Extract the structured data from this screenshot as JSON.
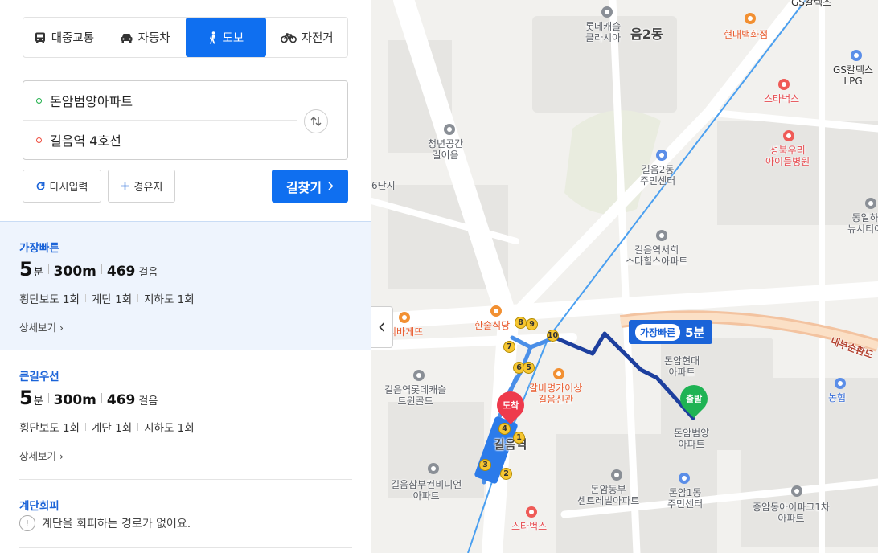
{
  "modes": [
    {
      "label": "대중교통",
      "icon": "bus-icon",
      "active": false
    },
    {
      "label": "자동차",
      "icon": "car-icon",
      "active": false
    },
    {
      "label": "도보",
      "icon": "walk-icon",
      "active": true
    },
    {
      "label": "자전거",
      "icon": "bicycle-icon",
      "active": false
    }
  ],
  "route": {
    "start": "돈암범양아파트",
    "end": "길음역 4호선"
  },
  "actions": {
    "reset": "다시입력",
    "waypoint": "경유지",
    "search": "길찾기"
  },
  "results": [
    {
      "title": "가장빠른",
      "minutes": "5",
      "minutes_unit": "분",
      "distance": "300m",
      "steps": "469",
      "steps_unit": "걸음",
      "details": [
        "횡단보도 1회",
        "계단 1회",
        "지하도 1회"
      ],
      "more": "상세보기"
    },
    {
      "title": "큰길우선",
      "minutes": "5",
      "minutes_unit": "분",
      "distance": "300m",
      "steps": "469",
      "steps_unit": "걸음",
      "details": [
        "횡단보도 1회",
        "계단 1회",
        "지하도 1회"
      ],
      "more": "상세보기"
    },
    {
      "title": "계단회피",
      "message": "계단을 회피하는 경로가 없어요."
    }
  ],
  "map": {
    "route_badge": {
      "tag": "가장빠른",
      "time": "5분"
    },
    "start_pin": "출발",
    "end_pin": "도착",
    "exit_numbers": [
      "1",
      "2",
      "3",
      "4",
      "5",
      "6",
      "7",
      "8",
      "9",
      "10"
    ],
    "labels": {
      "lotte_castle": "롯데캐슬\n클라시아",
      "gileum2dong": "음2동",
      "hyundai_dept": "현대백화점",
      "gs_caltex_top": "GS칼텍스",
      "gs_caltex_lpg": "GS칼텍스\nLPG",
      "starbucks_top": "스타벅스",
      "seongbuk_hospital": "성북우리\n아이들병원",
      "youth_space": "청년공간\n길이음",
      "gileum2_center": "길음2동\n주민센터",
      "danji6": "6단지",
      "dongil": "동일하\n뉴시티아",
      "hillstate": "길음역서희\n스타힐스아파트",
      "hansul": "한술식당",
      "ribagette": "리바게뜨",
      "lotte_castle_gold": "길음역롯데캐슬\n트윈골드",
      "galbi": "갈비명가이상\n길음신관",
      "gileum_station": "길음역",
      "donam_hyundai": "돈암현대\n아파트",
      "donam_beomyang": "돈암범양\n아파트",
      "nonghyup": "농협",
      "road_naebu": "내부순환도",
      "samboo": "길음삼부컨비니언\n아파트",
      "donambu_central": "돈암동부\n센트레빌아파트",
      "donam1_center": "돈암1동\n주민센터",
      "starbucks_bottom": "스타벅스",
      "jongam_park": "종암동아이파크1차\n아파트"
    }
  }
}
